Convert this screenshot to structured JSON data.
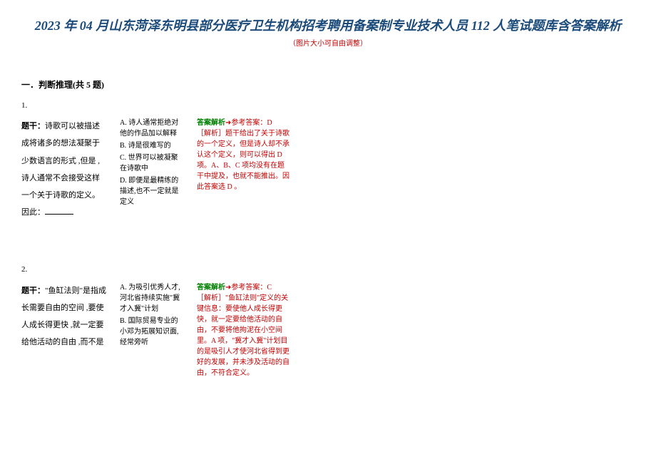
{
  "header": {
    "title": "2023 年 04 月山东菏泽东明县部分医疗卫生机构招考聘用备案制专业技术人员 112 人笔试题库含答案解析",
    "subtitle": "（图片大小可自由调整）"
  },
  "section": {
    "header": "一．判断推理(共 5 题)"
  },
  "questions": [
    {
      "number": "1.",
      "stem_label": "题干：",
      "stem": "诗歌可以被描述成将诸多的想法凝聚于少数语言的形式 ,但是 ,诗人通常不会接受这样一个关于诗歌的定义。因此：",
      "options": [
        "A. 诗人通常拒绝对他的作品加以解释",
        "B. 诗是很难写的",
        "C. 世界可以被凝聚在诗歌中",
        "D. 即便是最精练的描述,也不一定就是定义"
      ],
      "analysis": {
        "label": "答案解析",
        "arrow": "➜",
        "answer_prefix": "参考答案：D",
        "body": "［解析］题干给出了关于诗歌的一个定义，但是诗人却不承认这个定义，则可以得出 D 项。A、B、C 项均没有在题干中提及，也就不能推出。因此答案选 D 。"
      }
    },
    {
      "number": "2.",
      "stem_label": "题干：",
      "stem": "\"鱼缸法则\"是指成长需要自由的空间 ,要使人成长得更快 ,就一定要给他活动的自由 ,而不是",
      "options": [
        "A. 为吸引优秀人才,河北省持续实施\"冀才入冀\"计划",
        "B. 国际贸易专业的小邓为拓展知识面,经常旁听"
      ],
      "analysis": {
        "label": "答案解析",
        "arrow": "➜",
        "answer_prefix": "参考答案：C",
        "body": "［解析］\"鱼缸法则\"定义的关键信息：要使他人成长得更快，就一定要给他活动的自由，不要将他拘泥在小空间里。A 项，\"冀才入冀\"计划目的是吸引人才使河北省得到更好的发展，并未涉及活动的自由，不符合定义。"
      }
    }
  ]
}
